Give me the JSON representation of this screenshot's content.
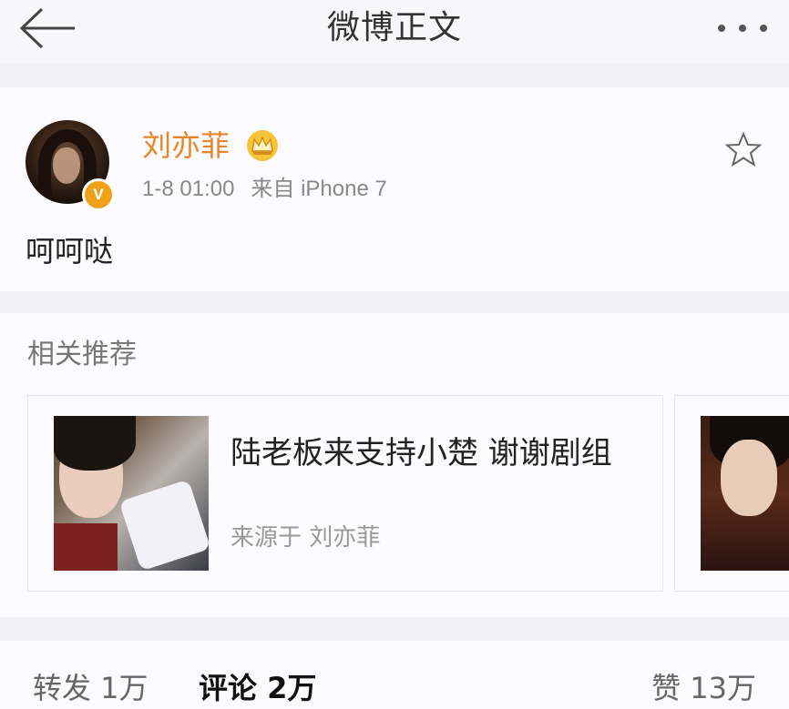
{
  "nav": {
    "title": "微博正文"
  },
  "post": {
    "username": "刘亦菲",
    "time": "1-8 01:00",
    "source": "来自 iPhone 7",
    "verified_badge": "V",
    "text": "呵呵哒",
    "accent_color": "#e8862a"
  },
  "related": {
    "title": "相关推荐",
    "cards": [
      {
        "headline": "陆老板来支持小楚 谢谢剧组",
        "source": "来源于 刘亦菲"
      }
    ]
  },
  "actions": {
    "repost": "转发 1万",
    "comment": "评论 2万",
    "like": "赞 13万"
  },
  "icons": [
    "back-arrow-icon",
    "more-dots-icon",
    "crown-icon",
    "star-icon",
    "verified-v-icon"
  ]
}
